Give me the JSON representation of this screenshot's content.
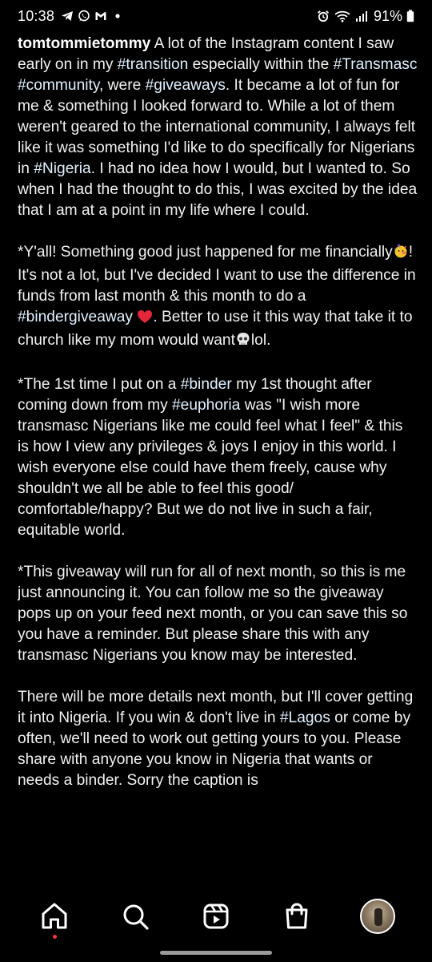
{
  "status_bar": {
    "time": "10:38",
    "left_icons": [
      "telegram-icon",
      "whatsapp-icon",
      "gmail-icon",
      "dot-icon"
    ],
    "right_icons": [
      "alarm-icon",
      "wifi-icon",
      "signal-icon",
      "battery-icon"
    ],
    "battery": "91%"
  },
  "post": {
    "username": "tomtommietommy",
    "p1": {
      "t0": " A lot of the Instagram content I saw early on in my ",
      "tag1": "#transition",
      "t1": " especially within the ",
      "tag2": "#Transmasc",
      "t2": " ",
      "tag3": "#community",
      "t3": ", were ",
      "tag4": "#giveaways",
      "t4": ". It became a lot of fun for me & something I looked forward to. While a lot of them weren't geared to the international community, I always felt like it was something I'd like to do specifically for Nigerians in ",
      "tag5": "#Nigeria",
      "t5": ". I had no idea how I would, but I wanted to. So when I had the thought to do this, I was excited by the idea that I am at a point in my life where I could."
    },
    "p2": {
      "t0": "*Y'all! Something good just happened for me financially",
      "emoji1": "party-face-emoji",
      "t1": "! It's not a lot, but I've decided I want to use the difference in funds from last month & this month to do a ",
      "tag1": "#bindergiveaway",
      "t2": " ",
      "emoji2": "red-heart-emoji",
      "t3": ". Better to use it this way that take it to church like my mom would want",
      "emoji3": "skull-emoji",
      "t4": "lol."
    },
    "p3": {
      "t0": "*The 1st time I put on a ",
      "tag1": "#binder",
      "t1": " my 1st thought after coming down from my ",
      "tag2": "#euphoria",
      "t2": " was \"I wish more transmasc Nigerians like me could feel what I feel\" & this is how I view any privileges & joys I enjoy in this world. I wish everyone else could have them freely, cause why shouldn't we all be able to feel this good/ comfortable/happy? But we do not live in such a fair, equitable world."
    },
    "p4": {
      "t0": "*This giveaway will run for all of next month, so this is me just announcing it. You can follow me so the giveaway pops up on your feed next month, or you can save this so you have a reminder. But please share this with any transmasc Nigerians you know may be interested."
    },
    "p5": {
      "t0": "There will be more details next month, but I'll cover getting it into Nigeria. If you win & don't live in ",
      "tag1": "#Lagos",
      "t1": " or come by often, we'll need to work out getting yours to you. Please share with anyone you know in Nigeria that wants or needs a binder. Sorry the caption is"
    }
  },
  "bottom_nav": {
    "items": [
      "home-icon",
      "search-icon",
      "reels-icon",
      "shop-icon",
      "profile-avatar"
    ],
    "active": "home-icon",
    "indicator_color": "#ff3040"
  },
  "colors": {
    "background": "#000000",
    "text": "#f2f2f2",
    "hashtag": "#e0f1ff"
  }
}
